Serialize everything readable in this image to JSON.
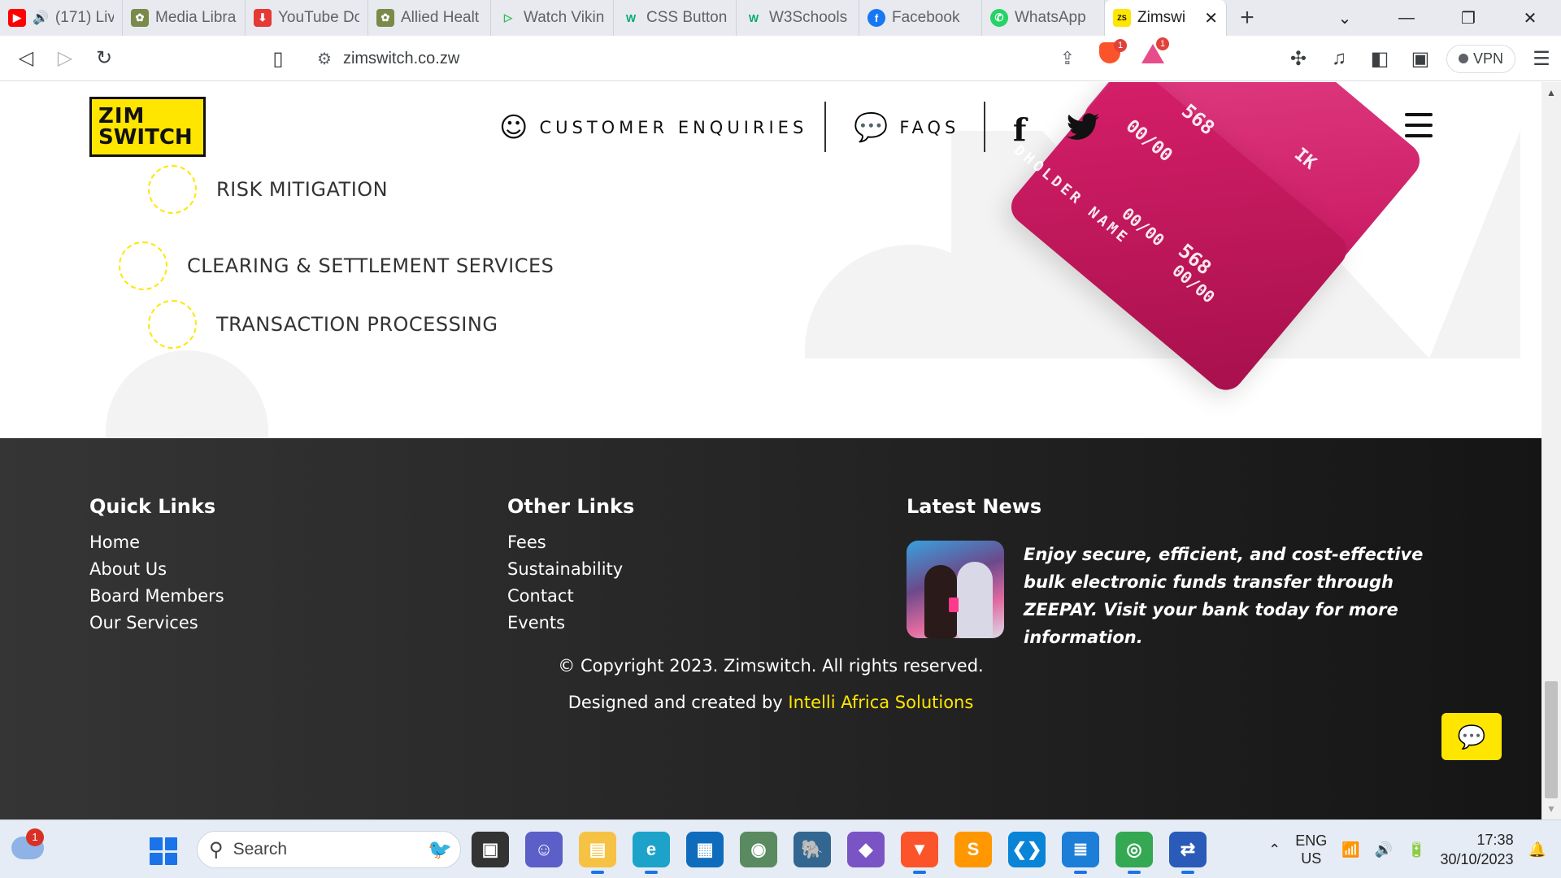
{
  "browser": {
    "tabs": [
      {
        "title": "(171) Liv",
        "icon": "youtube-icon",
        "color": "#ff0000"
      },
      {
        "title": "Media Libra",
        "icon": "wordpress-icon",
        "color": "#7a8a4a"
      },
      {
        "title": "YouTube Do",
        "icon": "download-icon",
        "color": "#e53935"
      },
      {
        "title": "Allied Healt",
        "icon": "allied-health-icon",
        "color": "#7a8a4a"
      },
      {
        "title": "Watch Vikin",
        "icon": "play-icon",
        "color": "#2bbf4f"
      },
      {
        "title": "CSS Buttons",
        "icon": "w3schools-icon",
        "color": "#04aa6d"
      },
      {
        "title": "W3Schools",
        "icon": "w3schools-icon",
        "color": "#04aa6d"
      },
      {
        "title": "Facebook",
        "icon": "facebook-icon",
        "color": "#1877f2"
      },
      {
        "title": "WhatsApp",
        "icon": "whatsapp-icon",
        "color": "#25d366"
      },
      {
        "title": "Zimswi",
        "icon": "zimswitch-icon",
        "color": "#ffe600"
      }
    ],
    "url": "zimswitch.co.zw",
    "vpn_label": "VPN",
    "brave_shield_count": "1",
    "rewards_count": "1"
  },
  "header": {
    "logo_line1": "ZIM",
    "logo_line2": "SWITCH",
    "nav_enquiries": "CUSTOMER ENQUIRIES",
    "nav_faqs": "FAQS",
    "facebook_glyph": "f"
  },
  "services": [
    "RISK MITIGATION",
    "CLEARING & SETTLEMENT SERVICES",
    "TRANSACTION PROCESSING"
  ],
  "cards": {
    "holder": "DHOLDER NAME",
    "valid": "00/00",
    "expires": "00/00",
    "expires2": "00/00",
    "num_back": "568",
    "num_front": "568",
    "brand_partial": "IK"
  },
  "footer": {
    "quick_links_title": "Quick Links",
    "quick_links": [
      "Home",
      "About Us",
      "Board Members",
      "Our Services"
    ],
    "other_links_title": "Other Links",
    "other_links": [
      "Fees",
      "Sustainability",
      "Contact",
      "Events"
    ],
    "news_title": "Latest News",
    "news_text": "Enjoy secure, efficient, and cost-effective bulk electronic funds transfer through ZEEPAY. Visit your bank today for more information.",
    "copyright": "© Copyright 2023. Zimswitch. All rights reserved.",
    "credit_prefix": "Designed and created by ",
    "credit_link": "Intelli Africa Solutions",
    "accent": "#ffe600"
  },
  "taskbar": {
    "search_placeholder": "Search",
    "weather_badge": "1",
    "lang_line1": "ENG",
    "lang_line2": "US",
    "time": "17:38",
    "date": "30/10/2023"
  }
}
